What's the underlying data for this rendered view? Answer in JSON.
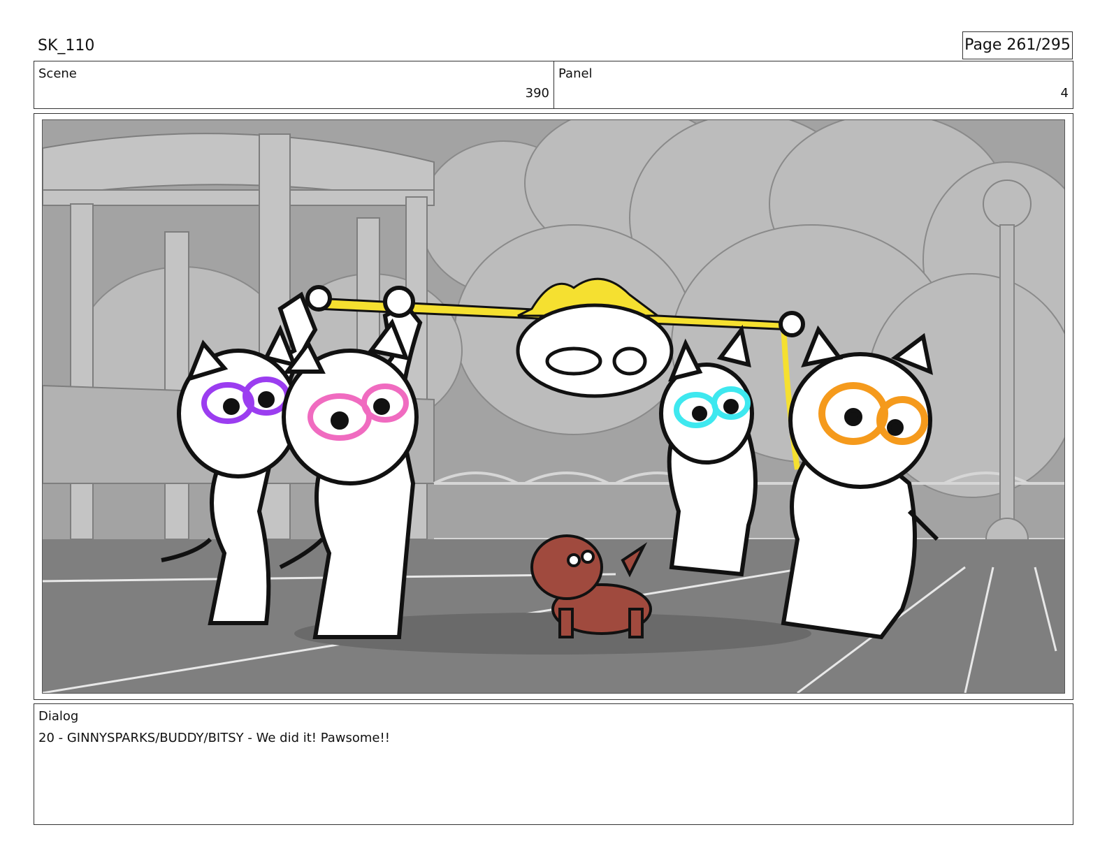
{
  "header": {
    "title": "SK_110",
    "page": "Page 261/295"
  },
  "scene": {
    "label": "Scene",
    "value": "390"
  },
  "panel": {
    "label": "Panel",
    "value": "4"
  },
  "frame": {
    "icon": "storyboard-drawing",
    "colors": {
      "background": "#9a9a9a",
      "ground": "#7d7d7d",
      "trees": "#b9b9b9",
      "ribbon": "#f5e030",
      "purple_eyes": "#9b3df0",
      "pink_eyes": "#f06bc0",
      "cyan_eyes": "#3ee8ef",
      "orange_eyes": "#f59a1c",
      "small_cat": "#a04a3e"
    }
  },
  "dialog": {
    "label": "Dialog",
    "text": "20 - GINNYSPARKS/BUDDY/BITSY - We did it! Pawsome!!"
  }
}
